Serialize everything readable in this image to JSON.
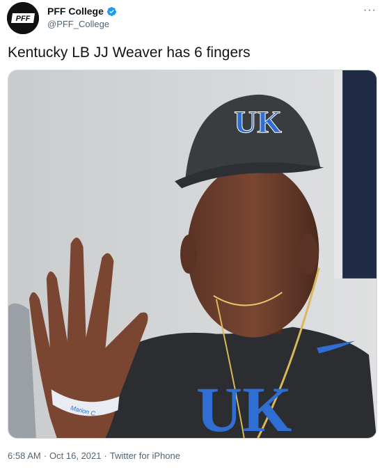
{
  "account": {
    "display_name": "PFF College",
    "handle": "@PFF_College",
    "avatar_text": "PFF",
    "verified_color": "#1d9bf0"
  },
  "tweet": {
    "text": "Kentucky LB JJ Weaver has 6 fingers",
    "more_label": "···"
  },
  "media": {
    "cap_logo": "UK",
    "shirt_logo": "UK",
    "wristband_text": "Marion C."
  },
  "meta": {
    "time": "6:58 AM",
    "separator": "·",
    "date": "Oct 16, 2021",
    "source": "Twitter for iPhone"
  }
}
